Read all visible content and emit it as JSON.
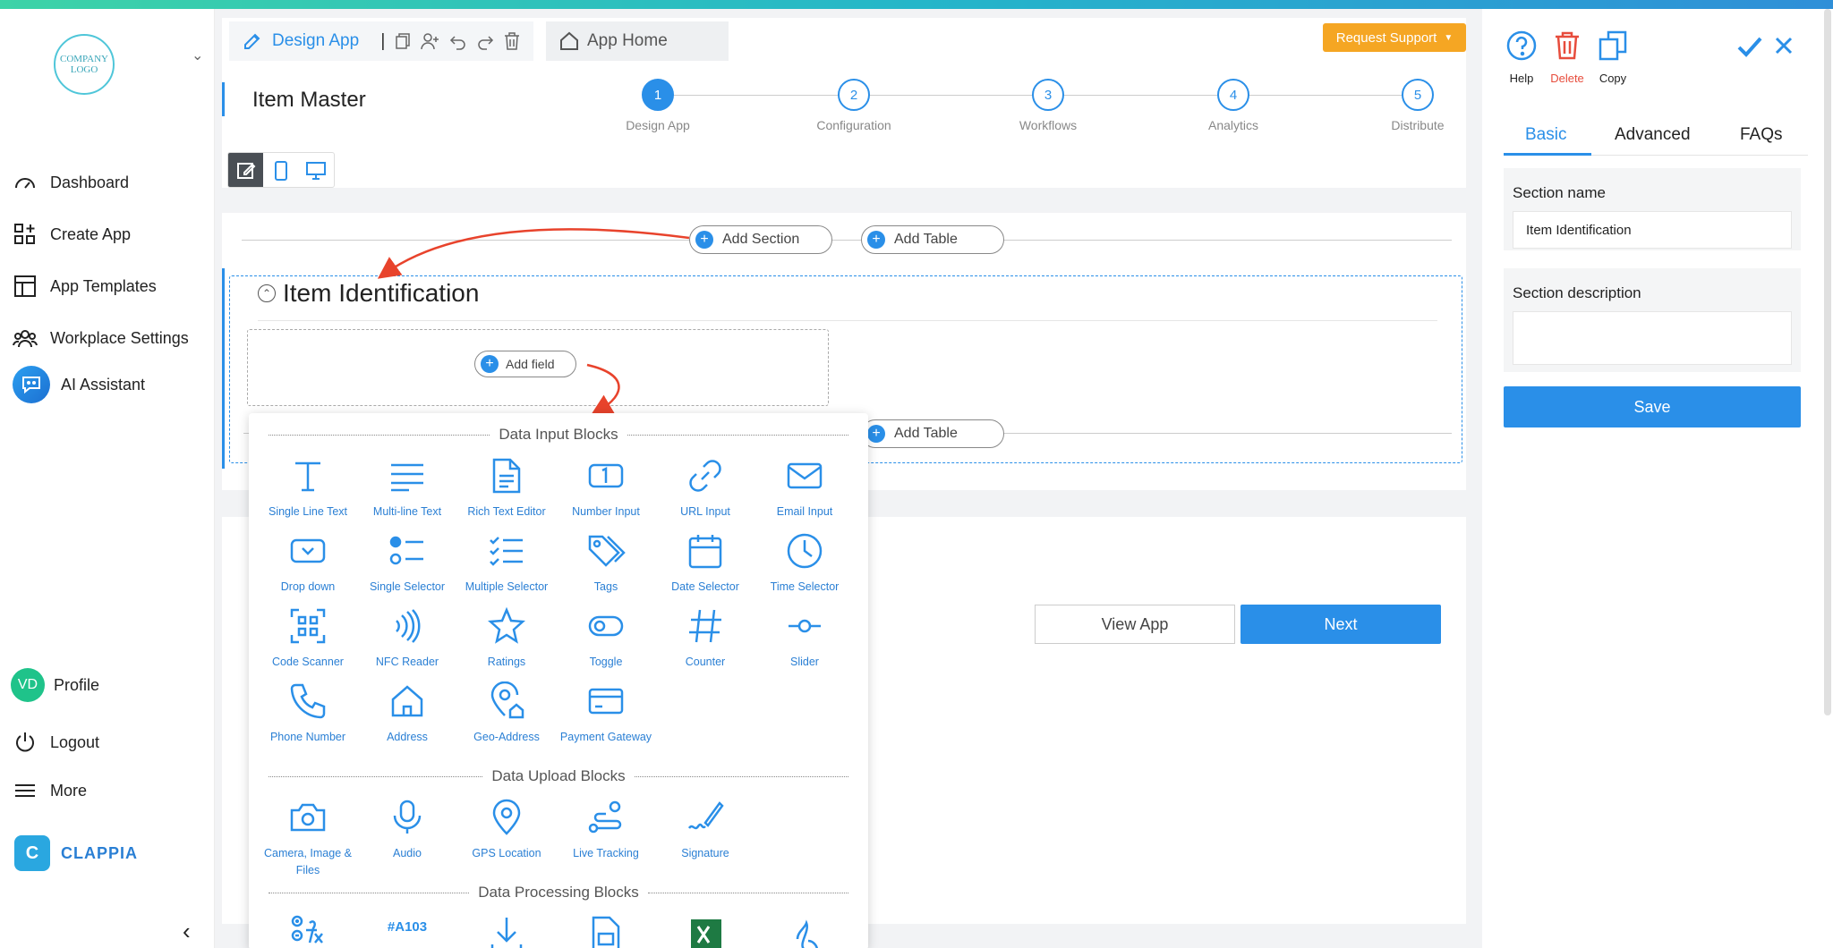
{
  "sidebar": {
    "logo_text": "COMPANY LOGO",
    "nav": [
      {
        "label": "Dashboard",
        "icon": "speedometer-icon"
      },
      {
        "label": "Create App",
        "icon": "apps-plus-icon"
      },
      {
        "label": "App Templates",
        "icon": "layout-icon"
      },
      {
        "label": "Workplace Settings",
        "icon": "people-icon"
      },
      {
        "label": "AI Assistant",
        "icon": "ai-chat-icon"
      }
    ],
    "profile": {
      "initials": "VD",
      "label": "Profile"
    },
    "logout": "Logout",
    "more": "More",
    "brand": "CLAPPIA",
    "brand_letter": "C"
  },
  "header": {
    "design_tab": "Design App",
    "separator": "|",
    "home_tab": "App Home",
    "request_support": "Request Support",
    "app_title": "Item Master"
  },
  "stepper": [
    {
      "num": "1",
      "label": "Design App",
      "active": true
    },
    {
      "num": "2",
      "label": "Configuration",
      "active": false
    },
    {
      "num": "3",
      "label": "Workflows",
      "active": false
    },
    {
      "num": "4",
      "label": "Analytics",
      "active": false
    },
    {
      "num": "5",
      "label": "Distribute",
      "active": false
    }
  ],
  "canvas": {
    "add_section": "Add Section",
    "add_table": "Add Table",
    "section_title": "Item Identification",
    "add_field": "Add field",
    "view_app": "View App",
    "next": "Next"
  },
  "popup": {
    "categories": [
      "Data Input Blocks",
      "Data Upload Blocks",
      "Data Processing Blocks"
    ],
    "input_blocks": [
      "Single Line Text",
      "Multi-line Text",
      "Rich Text Editor",
      "Number Input",
      "URL Input",
      "Email Input",
      "Drop down",
      "Single Selector",
      "Multiple Selector",
      "Tags",
      "Date Selector",
      "Time Selector",
      "Code Scanner",
      "NFC Reader",
      "Ratings",
      "Toggle",
      "Counter",
      "Slider",
      "Phone Number",
      "Address",
      "Geo-Address",
      "Payment Gateway"
    ],
    "upload_blocks": [
      "Camera, Image & Files",
      "Audio",
      "GPS Location",
      "Live Tracking",
      "Signature"
    ],
    "processing_visible": [
      "#A103"
    ]
  },
  "right_panel": {
    "actions": [
      {
        "label": "Help",
        "color": "#222222"
      },
      {
        "label": "Delete",
        "color": "#e74c3c"
      },
      {
        "label": "Copy",
        "color": "#222222"
      }
    ],
    "tabs": [
      "Basic",
      "Advanced",
      "FAQs"
    ],
    "active_tab": "Basic",
    "section_name_label": "Section name",
    "section_name_value": "Item Identification",
    "section_desc_label": "Section description",
    "section_desc_value": "",
    "save": "Save"
  },
  "colors": {
    "accent": "#2a8fe8",
    "support": "#f5a623",
    "delete": "#e74c3c",
    "arrow": "#e8432c"
  }
}
